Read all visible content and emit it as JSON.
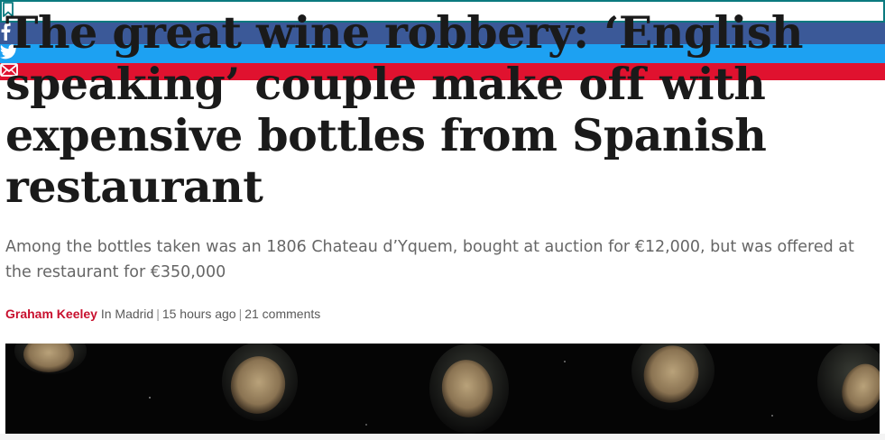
{
  "article": {
    "headline": "The great wine robbery: ‘English speaking’ couple make off with expensive bottles from Spanish restaurant",
    "standfirst": "Among the bottles taken was an 1806 Chateau d’Yquem, bought at auction for €12,000, but was offered at the restaurant for €350,000",
    "author": "Graham Keeley",
    "location": "In Madrid",
    "time_ago": "15 hours ago",
    "comments": "21 comments"
  },
  "share": {
    "icons": [
      "bookmark-icon",
      "facebook-icon",
      "twitter-icon",
      "email-icon"
    ],
    "colors": {
      "bookmark": "#0a7a7f",
      "facebook": "#3b5998",
      "twitter": "#1da1f2",
      "email": "#e0122f"
    }
  },
  "colors": {
    "author": "#c8102e",
    "headline": "#1a1a1a",
    "standfirst": "#666666"
  }
}
